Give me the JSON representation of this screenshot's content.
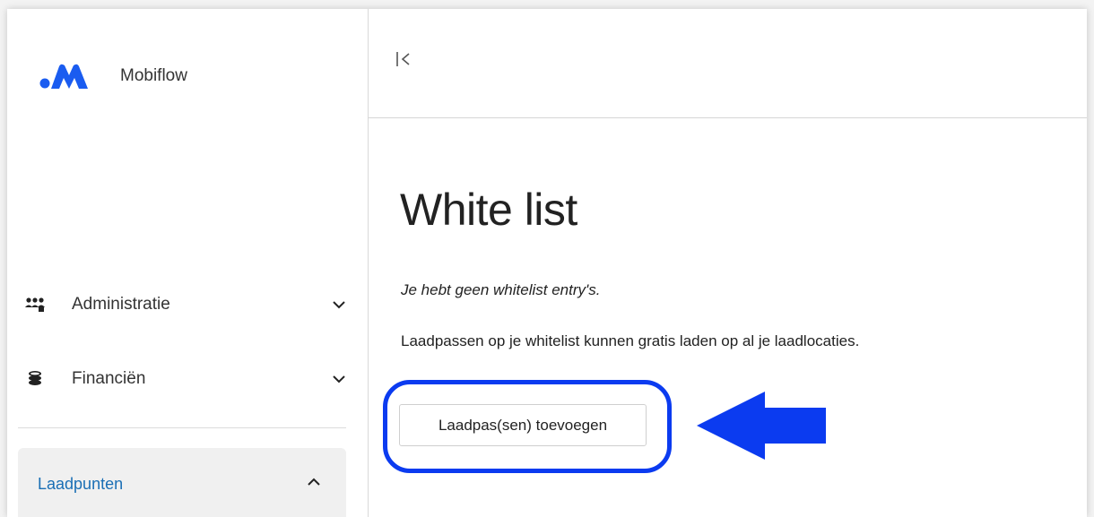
{
  "brand": {
    "name": "Mobiflow",
    "logo_icon": "mobiflow-logo-icon",
    "accent": "#1a5cf0"
  },
  "sidebar": {
    "items": [
      {
        "label": "Administratie",
        "icon": "users-icon",
        "expanded": false
      },
      {
        "label": "Financiën",
        "icon": "coins-icon",
        "expanded": false
      }
    ],
    "active_section": {
      "label": "Laadpunten",
      "expanded": true,
      "color": "#1a6fb5"
    }
  },
  "header": {
    "collapse_icon": "collapse-sidebar-icon"
  },
  "main": {
    "title": "White list",
    "empty_message": "Je hebt geen whitelist entry's.",
    "info_message": "Laadpassen op je whitelist kunnen gratis laden op al je laadlocaties.",
    "add_button_label": "Laadpas(sen) toevoegen"
  },
  "annotation": {
    "color": "#0b3bf0",
    "arrow_icon": "pointer-arrow-icon"
  }
}
